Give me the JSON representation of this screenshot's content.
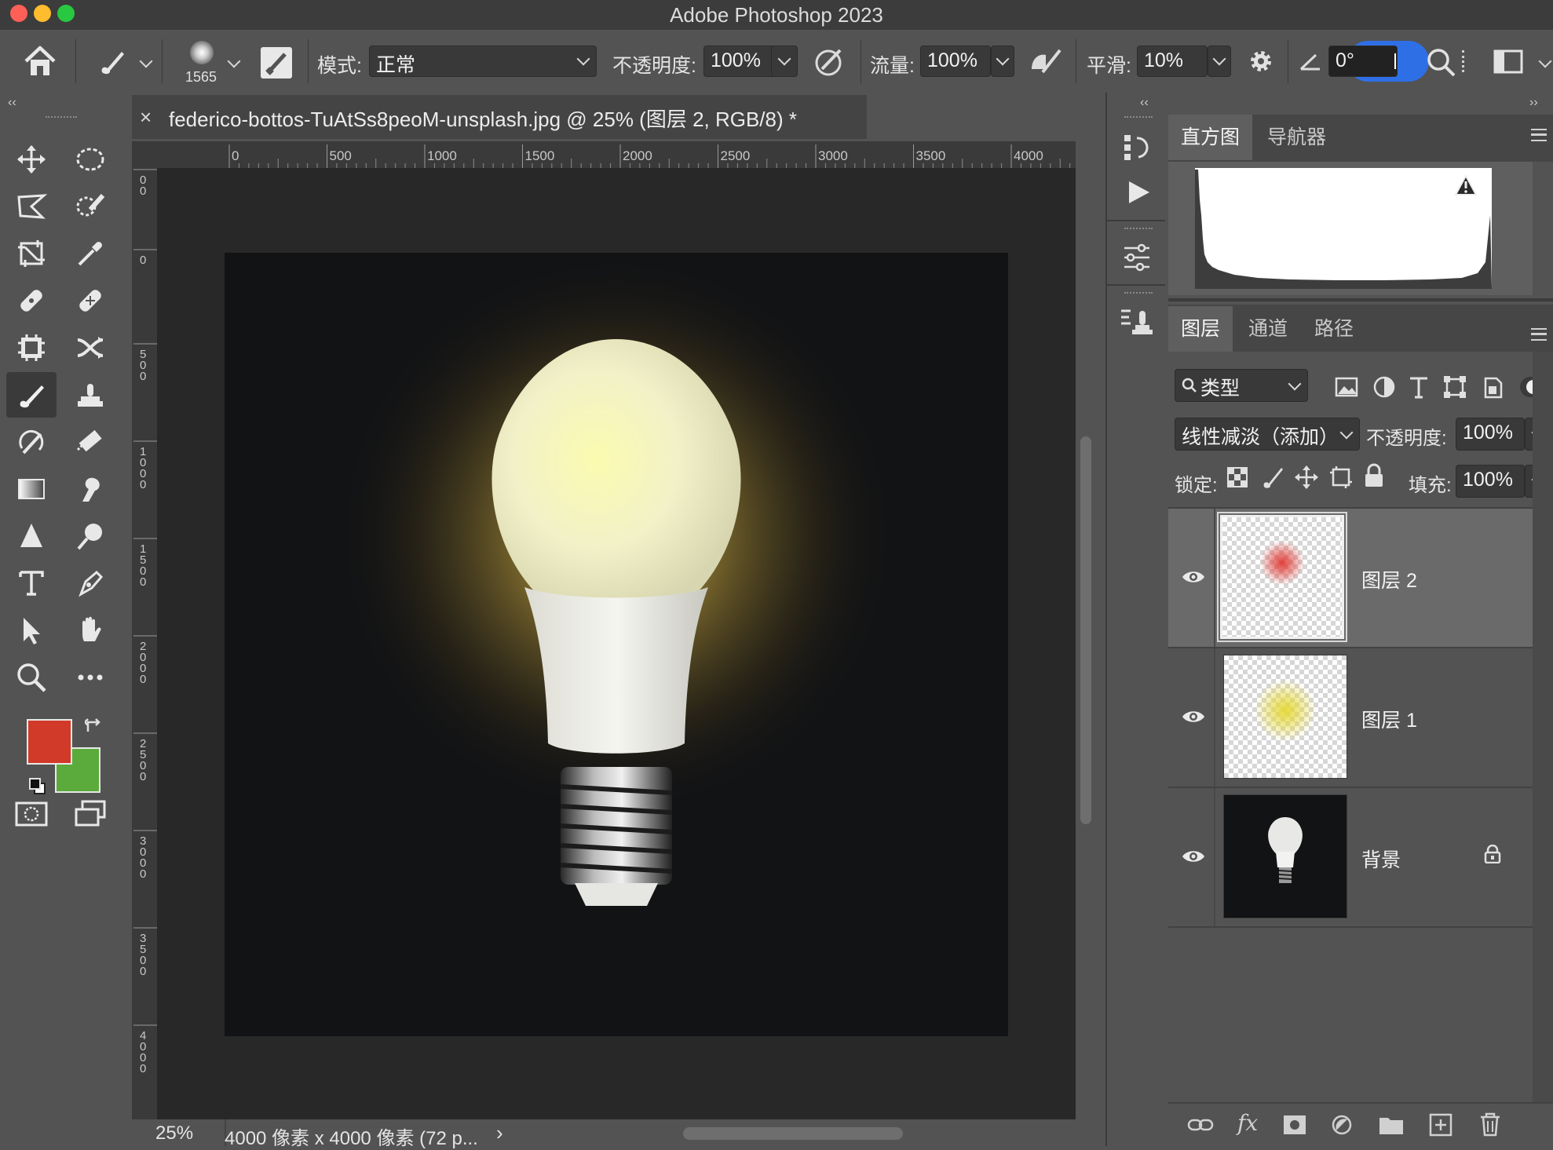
{
  "app": {
    "title": "Adobe Photoshop 2023"
  },
  "options_bar": {
    "brush_size": "1565",
    "mode_label": "模式:",
    "mode_value": "正常",
    "opacity_label": "不透明度:",
    "opacity_value": "100%",
    "flow_label": "流量:",
    "flow_value": "100%",
    "smoothing_label": "平滑:",
    "smoothing_value": "10%",
    "angle_value": "0°"
  },
  "document": {
    "tab_title": "federico-bottos-TuAtSs8peoM-unsplash.jpg @ 25% (图层 2, RGB/8) *",
    "close_glyph": "×",
    "zoom": "25%",
    "dimensions": "4000 像素 x 4000 像素 (72 p...",
    "status_chevron": "›",
    "hruler_ticks": [
      "0",
      "500",
      "1000",
      "1500",
      "2000",
      "2500",
      "3000",
      "3500",
      "4000"
    ],
    "vruler_ticks": [
      {
        "lines": [
          "0",
          "0"
        ]
      },
      {
        "lines": [
          "0"
        ]
      },
      {
        "lines": [
          "5",
          "0",
          "0"
        ]
      },
      {
        "lines": [
          "1",
          "0",
          "0",
          "0"
        ]
      },
      {
        "lines": [
          "1",
          "5",
          "0",
          "0"
        ]
      },
      {
        "lines": [
          "2",
          "0",
          "0",
          "0"
        ]
      },
      {
        "lines": [
          "2",
          "5",
          "0",
          "0"
        ]
      },
      {
        "lines": [
          "3",
          "0",
          "0",
          "0"
        ]
      },
      {
        "lines": [
          "3",
          "5",
          "0",
          "0"
        ]
      },
      {
        "lines": [
          "4",
          "0",
          "0",
          "0"
        ]
      }
    ]
  },
  "colors": {
    "foreground": "#d13a28",
    "background": "#5aab3c",
    "accent": "#2f6fe6"
  },
  "histogram_panel": {
    "tabs": [
      "直方图",
      "导航器"
    ],
    "active": "直方图"
  },
  "layers_panel": {
    "tabs": [
      "图层",
      "通道",
      "路径"
    ],
    "active": "图层",
    "filter_label": "类型",
    "blend_mode": "线性减淡（添加）",
    "opacity_label": "不透明度:",
    "opacity_value": "100%",
    "lock_label": "锁定:",
    "fill_label": "填充:",
    "fill_value": "100%",
    "layers": [
      {
        "name": "图层 2",
        "selected": true,
        "blob_color": "#e0403a"
      },
      {
        "name": "图层 1",
        "selected": false,
        "blob_color": "#e6d93c"
      },
      {
        "name": "背景",
        "selected": false,
        "locked": true
      }
    ]
  }
}
